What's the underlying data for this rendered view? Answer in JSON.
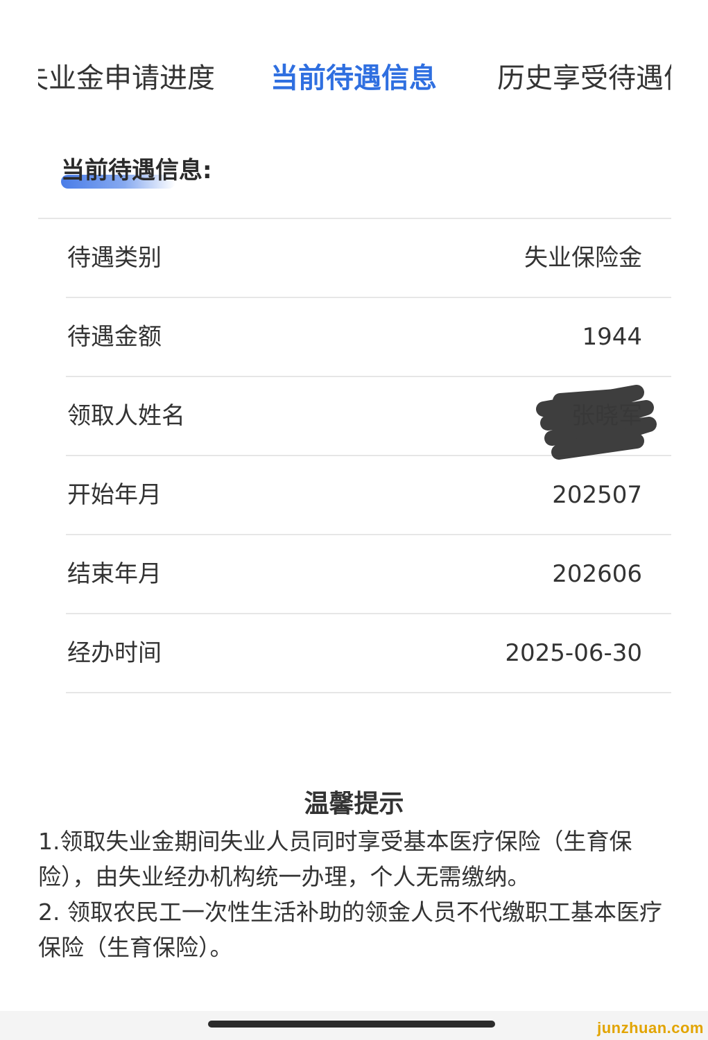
{
  "tabs": [
    {
      "label": "失业金申请进度",
      "active": false
    },
    {
      "label": "当前待遇信息",
      "active": true
    },
    {
      "label": "历史享受待遇信息",
      "active": false
    }
  ],
  "section": {
    "title": "当前待遇信息:"
  },
  "info": {
    "rows": [
      {
        "label": "待遇类别",
        "value": "失业保险金"
      },
      {
        "label": "待遇金额",
        "value": "1944"
      },
      {
        "label": "领取人姓名",
        "value": "张晓军",
        "redacted": true
      },
      {
        "label": "开始年月",
        "value": "202507"
      },
      {
        "label": "结束年月",
        "value": "202606"
      },
      {
        "label": "经办时间",
        "value": "2025-06-30"
      }
    ]
  },
  "tips": {
    "title": "温馨提示",
    "items": [
      "1.领取失业金期间失业人员同时享受基本医疗保险（生育保险），由失业经办机构统一办理，个人无需缴纳。",
      "2. 领取农民工一次性生活补助的领金人员不代缴职工基本医疗保险（生育保险）。"
    ]
  },
  "watermark": "junzhuan.com",
  "colors": {
    "active_tab": "#2f6fe0",
    "divider": "#e6e6e6",
    "text": "#333333",
    "watermark": "#e2a400"
  }
}
